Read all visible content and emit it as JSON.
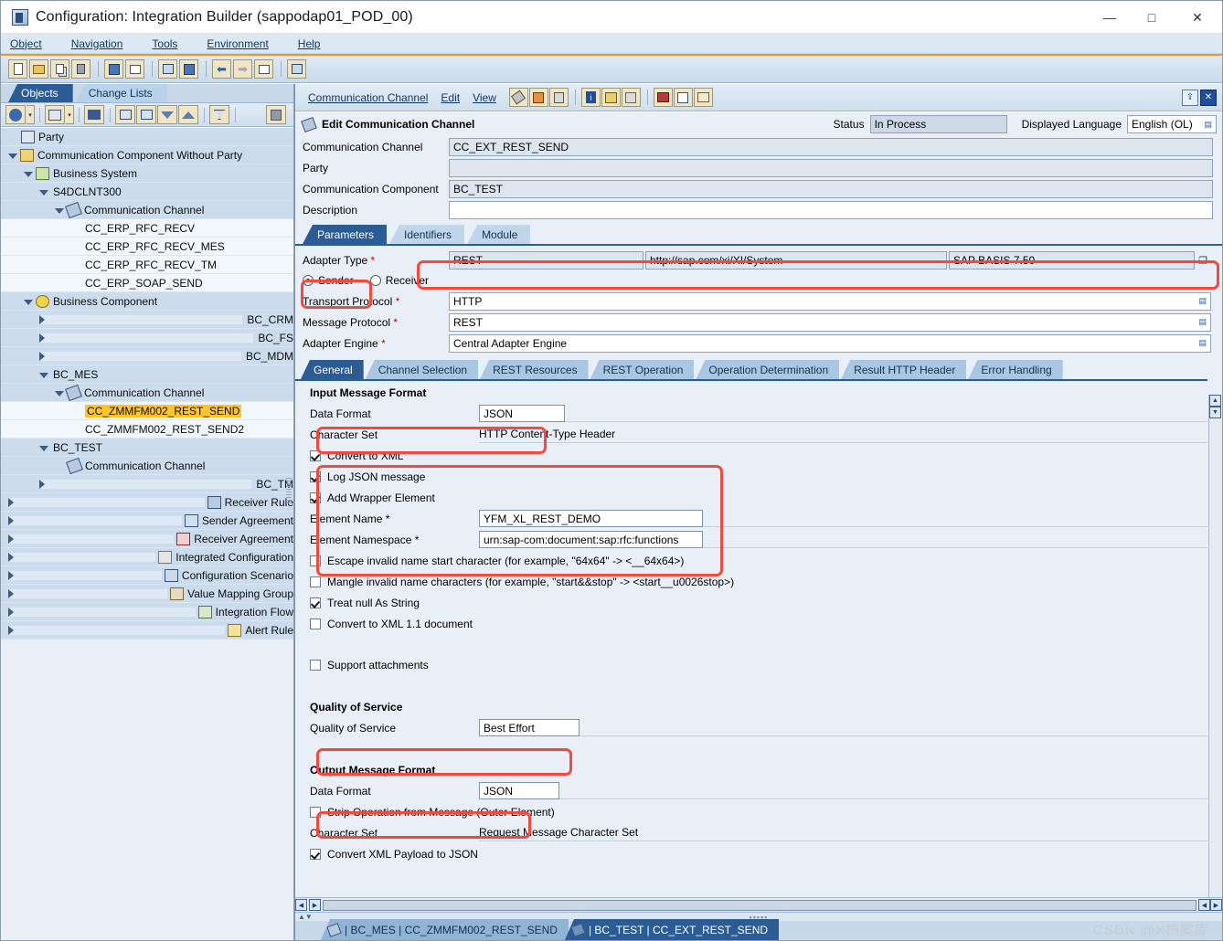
{
  "window": {
    "title": "Configuration: Integration Builder (sappodap01_POD_00)",
    "minimize": "—",
    "maximize": "□",
    "close": "✕"
  },
  "menubar": [
    "Object",
    "Navigation",
    "Tools",
    "Environment",
    "Help"
  ],
  "toolbar": {
    "buttons": [
      "new-document",
      "open-folder",
      "copy",
      "delete",
      "save-all",
      "check-objects",
      "transport",
      "where-used",
      "back",
      "forward",
      "list-view",
      "properties"
    ]
  },
  "sidebar": {
    "tabs": [
      {
        "label": "Objects",
        "active": true
      },
      {
        "label": "Change Lists",
        "active": false
      }
    ],
    "toolbar_buttons": [
      "refresh",
      "scope",
      "find",
      "expand-all",
      "collapse-all",
      "move-down",
      "move-up",
      "filter",
      "stop"
    ],
    "tree": [
      {
        "label": "Party",
        "indent": 0,
        "twist": "none",
        "icon": "party",
        "shade": "shade"
      },
      {
        "label": "Communication Component Without Party",
        "indent": 0,
        "twist": "down",
        "icon": "comp",
        "shade": "shade"
      },
      {
        "label": "Business System",
        "indent": 1,
        "twist": "down",
        "icon": "bsys",
        "shade": "shade"
      },
      {
        "label": "S4DCLNT300",
        "indent": 2,
        "twist": "down",
        "icon": "none",
        "shade": "shade"
      },
      {
        "label": "Communication Channel",
        "indent": 3,
        "twist": "down",
        "icon": "chan",
        "shade": "shade"
      },
      {
        "label": "CC_ERP_RFC_RECV",
        "indent": 4,
        "twist": "none",
        "icon": "none",
        "shade": "plain"
      },
      {
        "label": "CC_ERP_RFC_RECV_MES",
        "indent": 4,
        "twist": "none",
        "icon": "none",
        "shade": "plain"
      },
      {
        "label": "CC_ERP_RFC_RECV_TM",
        "indent": 4,
        "twist": "none",
        "icon": "none",
        "shade": "plain"
      },
      {
        "label": "CC_ERP_SOAP_SEND",
        "indent": 4,
        "twist": "none",
        "icon": "none",
        "shade": "plain"
      },
      {
        "label": "Business Component",
        "indent": 1,
        "twist": "down",
        "icon": "bcomp",
        "shade": "shade"
      },
      {
        "label": "BC_CRM",
        "indent": 2,
        "twist": "right",
        "icon": "none",
        "shade": "shade"
      },
      {
        "label": "BC_FS",
        "indent": 2,
        "twist": "right",
        "icon": "none",
        "shade": "shade"
      },
      {
        "label": "BC_MDM",
        "indent": 2,
        "twist": "right",
        "icon": "none",
        "shade": "shade"
      },
      {
        "label": "BC_MES",
        "indent": 2,
        "twist": "down",
        "icon": "none",
        "shade": "shade"
      },
      {
        "label": "Communication Channel",
        "indent": 3,
        "twist": "down",
        "icon": "chan",
        "shade": "shade"
      },
      {
        "label": "CC_ZMMFM002_REST_SEND",
        "indent": 4,
        "twist": "none",
        "icon": "none",
        "shade": "plain",
        "selected": true
      },
      {
        "label": "CC_ZMMFM002_REST_SEND2",
        "indent": 4,
        "twist": "none",
        "icon": "none",
        "shade": "plain"
      },
      {
        "label": "BC_TEST",
        "indent": 2,
        "twist": "down",
        "icon": "none",
        "shade": "shade"
      },
      {
        "label": "Communication Channel",
        "indent": 3,
        "twist": "none",
        "icon": "chan",
        "shade": "shade"
      },
      {
        "label": "BC_TM",
        "indent": 2,
        "twist": "right",
        "icon": "none",
        "shade": "shade"
      },
      {
        "label": "Receiver Rule",
        "indent": 0,
        "twist": "right",
        "icon": "rule",
        "shade": "shade"
      },
      {
        "label": "Sender Agreement",
        "indent": 0,
        "twist": "right",
        "icon": "send",
        "shade": "shade"
      },
      {
        "label": "Receiver Agreement",
        "indent": 0,
        "twist": "right",
        "icon": "recv",
        "shade": "shade"
      },
      {
        "label": "Integrated Configuration",
        "indent": 0,
        "twist": "right",
        "icon": "intcfg",
        "shade": "shade"
      },
      {
        "label": "Configuration Scenario",
        "indent": 0,
        "twist": "right",
        "icon": "scen",
        "shade": "shade"
      },
      {
        "label": "Value Mapping Group",
        "indent": 0,
        "twist": "right",
        "icon": "vmap",
        "shade": "shade"
      },
      {
        "label": "Integration Flow",
        "indent": 0,
        "twist": "right",
        "icon": "iflow",
        "shade": "shade"
      },
      {
        "label": "Alert Rule",
        "indent": 0,
        "twist": "right",
        "icon": "alert",
        "shade": "shade"
      }
    ]
  },
  "editor": {
    "menu": [
      "Communication Channel",
      "Edit",
      "View"
    ],
    "toolbar_buttons": [
      "edit-pen",
      "save",
      "copies",
      "info",
      "where-used",
      "history",
      "deploy",
      "table-view",
      "log-view"
    ],
    "right_buttons": [
      "pin",
      "close"
    ],
    "header": {
      "title": "Edit Communication Channel",
      "status_label": "Status",
      "status_value": "In Process",
      "language_label": "Displayed Language",
      "language_value": "English (OL)"
    },
    "fields": [
      {
        "label": "Communication Channel",
        "value": "CC_EXT_REST_SEND",
        "style": "ro"
      },
      {
        "label": "Party",
        "value": "",
        "style": "ro"
      },
      {
        "label": "Communication Component",
        "value": "BC_TEST",
        "style": "ro"
      },
      {
        "label": "Description",
        "value": "",
        "style": "white"
      }
    ],
    "outer_tabs": [
      {
        "label": "Parameters",
        "active": true
      },
      {
        "label": "Identifiers",
        "active": false
      },
      {
        "label": "Module",
        "active": false
      }
    ],
    "adapter": {
      "label": "Adapter Type",
      "required": "*",
      "type": "REST",
      "namespace": "http://sap.com/xi/XI/System",
      "swcv": "SAP BASIS 7.50",
      "picker_icon": "value-help-icon"
    },
    "direction": {
      "sender_label": "Sender",
      "receiver_label": "Receiver",
      "selected": "Sender"
    },
    "protocol_fields": [
      {
        "label": "Transport Protocol",
        "required": "*",
        "value": "HTTP"
      },
      {
        "label": "Message Protocol",
        "required": "*",
        "value": "REST"
      },
      {
        "label": "Adapter Engine",
        "required": "*",
        "value": "Central Adapter Engine"
      }
    ],
    "inner_tabs": [
      {
        "label": "General",
        "active": true
      },
      {
        "label": "Channel Selection",
        "active": false
      },
      {
        "label": "REST Resources",
        "active": false
      },
      {
        "label": "REST Operation",
        "active": false
      },
      {
        "label": "Operation Determination",
        "active": false
      },
      {
        "label": "Result HTTP Header",
        "active": false
      },
      {
        "label": "Error Handling",
        "active": false
      }
    ],
    "general": {
      "input_section_title": "Input Message Format",
      "input_data_format_label": "Data Format",
      "input_data_format_value": "JSON",
      "input_charset_label": "Character Set",
      "input_charset_value": "HTTP Content-Type Header",
      "checks_top": [
        {
          "label": "Convert to XML",
          "checked": true
        },
        {
          "label": "Log JSON message",
          "checked": true
        },
        {
          "label": "Add Wrapper Element",
          "checked": true
        }
      ],
      "element_name_label": "Element Name",
      "element_name_required": "*",
      "element_name_value": "YFM_XL_REST_DEMO",
      "element_ns_label": "Element Namespace",
      "element_ns_required": "*",
      "element_ns_value": "urn:sap-com:document:sap:rfc:functions",
      "checks_mid": [
        {
          "label": "Escape invalid name start character (for example, \"64x64\" -> <__64x64>)",
          "checked": false
        },
        {
          "label": "Mangle invalid name characters (for example, \"start&&stop\" -> <start__u0026stop>)",
          "checked": false
        },
        {
          "label": "Treat null As String",
          "checked": true
        },
        {
          "label": "Convert to XML 1.1 document",
          "checked": false
        }
      ],
      "support_attachments": {
        "label": "Support attachments",
        "checked": false
      },
      "qos_section_title": "Quality of Service",
      "qos_label": "Quality of Service",
      "qos_value": "Best Effort",
      "output_section_title": "Output Message Format",
      "output_data_format_label": "Data Format",
      "output_data_format_value": "JSON",
      "strip_operation": {
        "label": "Strip Operation from Message (Outer Element)",
        "checked": false
      },
      "output_charset_label": "Character Set",
      "output_charset_value": "Request Message Character Set",
      "convert_payload": {
        "label": "Convert XML Payload to JSON",
        "checked": true
      }
    }
  },
  "bottom_tabs": [
    {
      "label": "| BC_MES | CC_ZMMFM002_REST_SEND",
      "active": false
    },
    {
      "label": "| BC_TEST | CC_EXT_REST_SEND",
      "active": true
    }
  ],
  "watermark": "CSDN @X档案库",
  "colors": {
    "accent": "#2b5c96",
    "highlight": "#f8483c",
    "selection": "#ffc425",
    "orange_rule": "#ef9b20"
  }
}
